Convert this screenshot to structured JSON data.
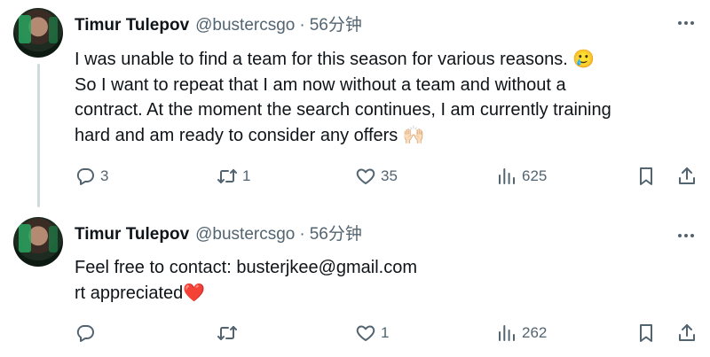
{
  "tweets": [
    {
      "author": {
        "name": "Timur Tulepov",
        "handle": "@bustercsgo",
        "separator": "·",
        "time": "56分钟"
      },
      "lines": [
        "I was unable to find a team for this season for various reasons. 🥲",
        "So I want to repeat that I am now without a team and without a",
        "contract. At the moment the search continues, I am currently training",
        "hard and am ready to consider any offers 🙌🏻"
      ],
      "actions": {
        "replies": "3",
        "retweets": "1",
        "likes": "35",
        "views": "625"
      },
      "icons": [
        "reply-icon",
        "retweet-icon",
        "like-icon",
        "views-icon",
        "bookmark-icon",
        "share-icon",
        "more-icon"
      ]
    },
    {
      "author": {
        "name": "Timur Tulepov",
        "handle": "@bustercsgo",
        "separator": "·",
        "time": "56分钟"
      },
      "lines": [
        "Feel free to contact: busterjkee@gmail.com",
        "rt appreciated❤️"
      ],
      "actions": {
        "replies": "",
        "retweets": "",
        "likes": "1",
        "views": "262"
      },
      "icons": [
        "reply-icon",
        "retweet-icon",
        "like-icon",
        "views-icon",
        "bookmark-icon",
        "share-icon",
        "more-icon"
      ]
    }
  ],
  "colors": {
    "text": "#0f1419",
    "secondary": "#536471",
    "thread_line": "#cfd9de",
    "background": "#ffffff"
  }
}
